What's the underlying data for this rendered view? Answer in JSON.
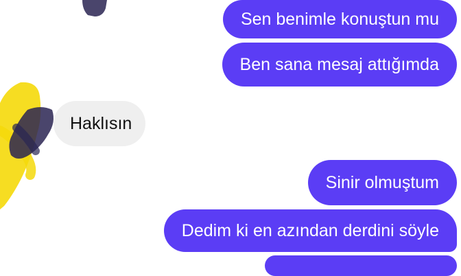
{
  "conversation": {
    "messages": [
      {
        "direction": "outgoing",
        "text": "Sen benimle konuştun mu"
      },
      {
        "direction": "outgoing",
        "text": "Ben sana mesaj attığımda"
      },
      {
        "direction": "incoming",
        "text": "Haklısın"
      },
      {
        "direction": "outgoing",
        "text": "Sinir olmuştum"
      },
      {
        "direction": "outgoing",
        "text": "Dedim ki en azından derdini söyle"
      }
    ]
  },
  "theme": {
    "outgoing_bubble_color": "#5b3df5",
    "incoming_bubble_color": "#efefef",
    "redaction_colors": [
      "#f5d90a",
      "#2a2552"
    ]
  },
  "icons": [
    "redaction-scribble-icon"
  ]
}
